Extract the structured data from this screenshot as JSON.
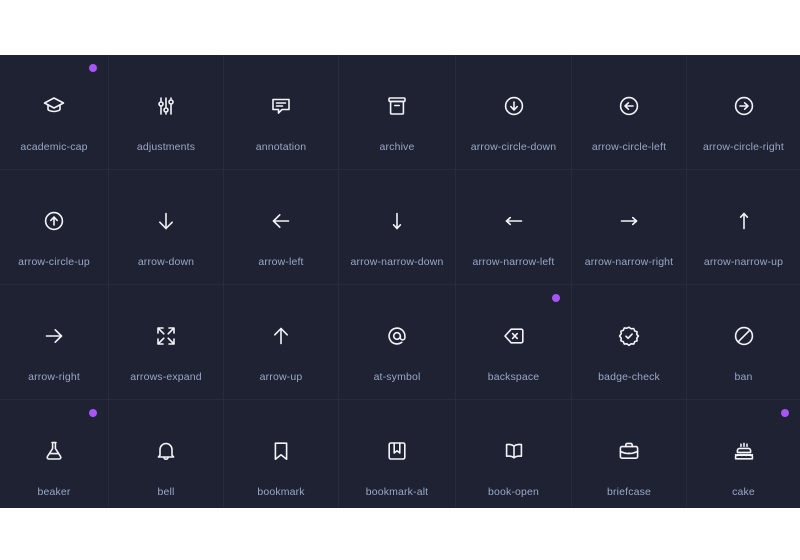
{
  "page": {
    "background_color": "#ffffff",
    "grid_background_color": "#1b1f30",
    "cell_background_color": "#1e2233",
    "cell_divider_color": "#262b3d",
    "label_color": "#9aa8c7",
    "icon_color": "#f2f4f8",
    "dot_color": "#a855f7",
    "columns": 7,
    "visible_rows": 4
  },
  "icons": [
    {
      "label": "academic-cap",
      "icon": "academic-cap-icon",
      "dot": true
    },
    {
      "label": "adjustments",
      "icon": "adjustments-icon",
      "dot": false
    },
    {
      "label": "annotation",
      "icon": "annotation-icon",
      "dot": false
    },
    {
      "label": "archive",
      "icon": "archive-icon",
      "dot": false
    },
    {
      "label": "arrow-circle-down",
      "icon": "arrow-circle-down-icon",
      "dot": false
    },
    {
      "label": "arrow-circle-left",
      "icon": "arrow-circle-left-icon",
      "dot": false
    },
    {
      "label": "arrow-circle-right",
      "icon": "arrow-circle-right-icon",
      "dot": false
    },
    {
      "label": "arrow-circle-up",
      "icon": "arrow-circle-up-icon",
      "dot": false
    },
    {
      "label": "arrow-down",
      "icon": "arrow-down-icon",
      "dot": false
    },
    {
      "label": "arrow-left",
      "icon": "arrow-left-icon",
      "dot": false
    },
    {
      "label": "arrow-narrow-down",
      "icon": "arrow-narrow-down-icon",
      "dot": false
    },
    {
      "label": "arrow-narrow-left",
      "icon": "arrow-narrow-left-icon",
      "dot": false
    },
    {
      "label": "arrow-narrow-right",
      "icon": "arrow-narrow-right-icon",
      "dot": false
    },
    {
      "label": "arrow-narrow-up",
      "icon": "arrow-narrow-up-icon",
      "dot": false
    },
    {
      "label": "arrow-right",
      "icon": "arrow-right-icon",
      "dot": false
    },
    {
      "label": "arrows-expand",
      "icon": "arrows-expand-icon",
      "dot": false
    },
    {
      "label": "arrow-up",
      "icon": "arrow-up-icon",
      "dot": false
    },
    {
      "label": "at-symbol",
      "icon": "at-symbol-icon",
      "dot": false
    },
    {
      "label": "backspace",
      "icon": "backspace-icon",
      "dot": true
    },
    {
      "label": "badge-check",
      "icon": "badge-check-icon",
      "dot": false
    },
    {
      "label": "ban",
      "icon": "ban-icon",
      "dot": false
    },
    {
      "label": "beaker",
      "icon": "beaker-icon",
      "dot": true
    },
    {
      "label": "bell",
      "icon": "bell-icon",
      "dot": false
    },
    {
      "label": "bookmark",
      "icon": "bookmark-icon",
      "dot": false
    },
    {
      "label": "bookmark-alt",
      "icon": "bookmark-alt-icon",
      "dot": false
    },
    {
      "label": "book-open",
      "icon": "book-open-icon",
      "dot": false
    },
    {
      "label": "briefcase",
      "icon": "briefcase-icon",
      "dot": false
    },
    {
      "label": "cake",
      "icon": "cake-icon",
      "dot": true
    }
  ]
}
